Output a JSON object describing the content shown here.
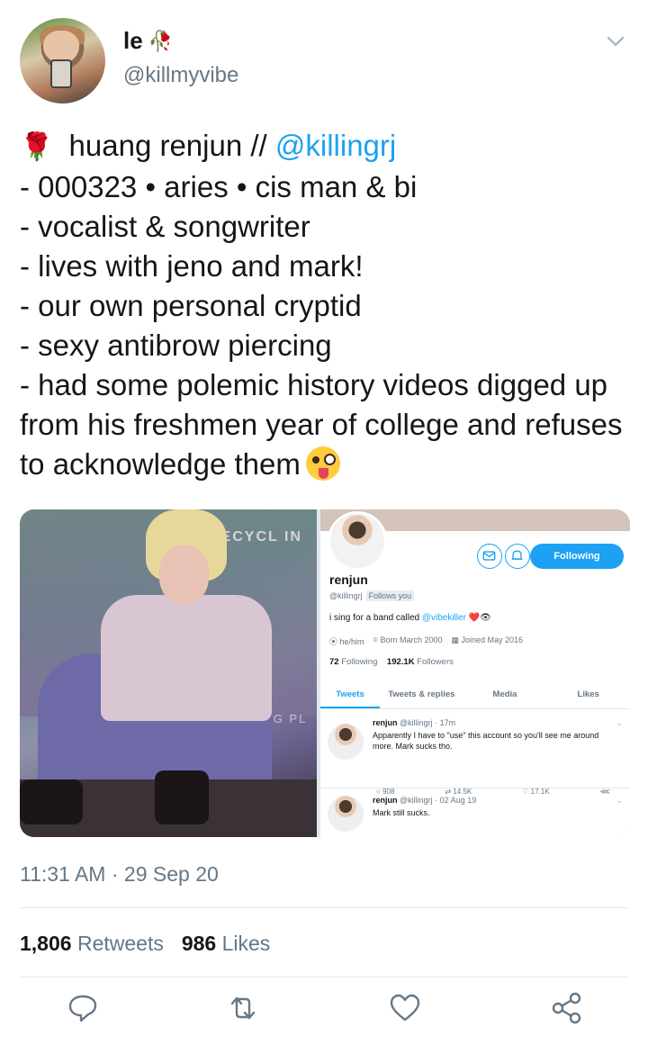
{
  "tweet": {
    "display_name": "le",
    "display_name_emoji": "🥀",
    "handle": "@killmyvibe",
    "text_lines": [
      {
        "prefix": "🌹",
        "text": " huang renjun // ",
        "mention": "@killingrj"
      },
      {
        "text": "- 000323 • aries • cis man & bi"
      },
      {
        "text": "- vocalist & songwriter"
      },
      {
        "text": "- lives with jeno and mark!"
      },
      {
        "text": "- our own personal cryptid"
      },
      {
        "text": "- sexy antibrow piercing"
      },
      {
        "text": "- had some polemic history videos digged up from his freshmen year of college and refuses to acknowledge them"
      }
    ],
    "timestamp": "11:31 AM · 29 Sep 20",
    "stats": {
      "retweets_count": "1,806",
      "retweets_label": "Retweets",
      "likes_count": "986",
      "likes_label": "Likes"
    }
  },
  "media_left": {
    "sign_text": "RECYCL IN",
    "sign_text_2": "MPLING PL"
  },
  "embedded_profile": {
    "name": "renjun",
    "handle": "@killingrj",
    "follows_you": "Follows you",
    "follow_button": "Following",
    "bio_prefix": "i sing for a band called ",
    "bio_mention": "@vibekiller",
    "bio_suffix": " ❤️👁",
    "pronouns": "he/him",
    "born": "Born March 2000",
    "joined": "Joined May 2016",
    "following_count": "72",
    "following_label": "Following",
    "followers_count": "192.1K",
    "followers_label": "Followers",
    "tabs": [
      "Tweets",
      "Tweets & replies",
      "Media",
      "Likes"
    ],
    "tweets": [
      {
        "name": "renjun",
        "meta": "@killingrj · 17m",
        "text": "Apparently I have to \"use\" this account so you'll see me around more. Mark sucks tho.",
        "replies": "908",
        "retweets": "14.5K",
        "likes": "17.1K"
      },
      {
        "name": "renjun",
        "meta": "@killingrj · 02 Aug 19",
        "text": "Mark still sucks."
      }
    ]
  },
  "colors": {
    "accent": "#1da1f2",
    "text_primary": "#14171a",
    "text_secondary": "#657786",
    "divider": "#e1e8ed"
  },
  "icons": [
    "chevron-down-icon",
    "reply-icon",
    "retweet-icon",
    "like-icon",
    "share-icon"
  ]
}
